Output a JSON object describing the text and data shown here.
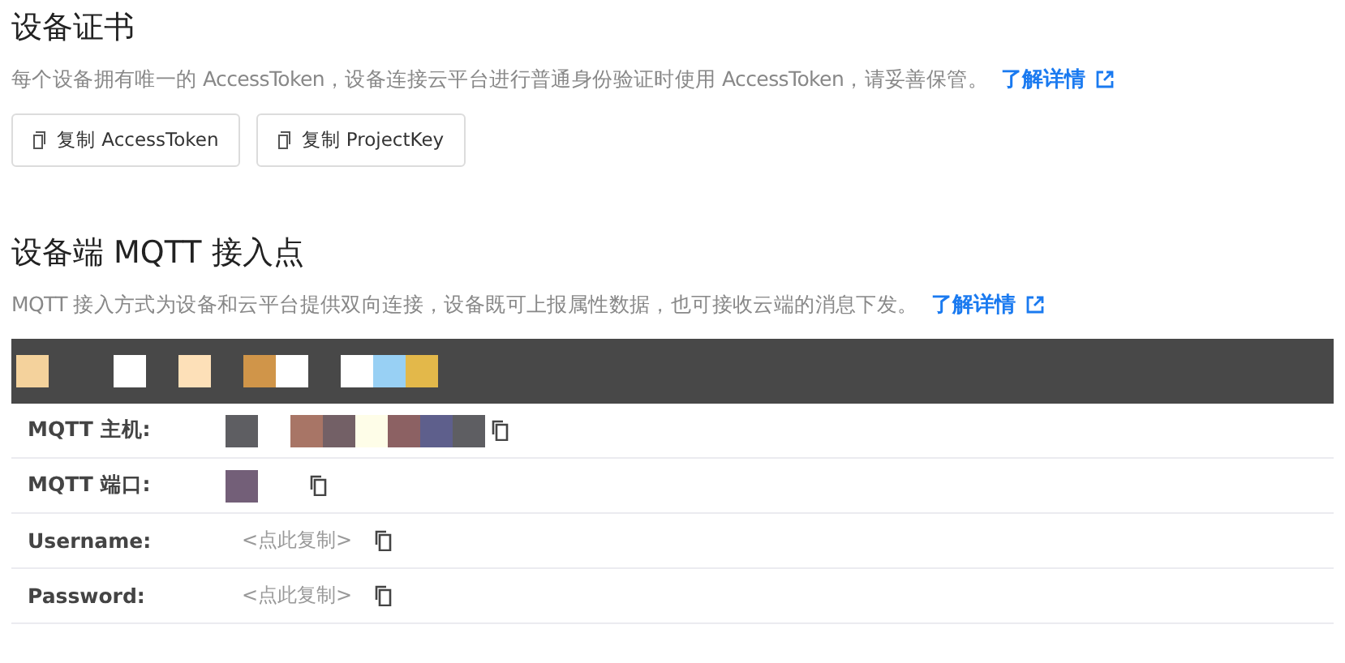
{
  "certificate": {
    "title": "设备证书",
    "description": "每个设备拥有唯一的 AccessToken，设备连接云平台进行普通身份验证时使用 AccessToken，请妥善保管。",
    "link": "了解详情",
    "buttons": [
      "复制 AccessToken",
      "复制 ProjectKey"
    ]
  },
  "mqtt": {
    "title": "设备端 MQTT 接入点",
    "description": "MQTT 接入方式为设备和云平台提供双向连接，设备既可上报属性数据，也可接收云端的消息下发。",
    "link": "了解详情",
    "rows": [
      {
        "label": "MQTT 主机:",
        "kind": "masked_host"
      },
      {
        "label": "MQTT 端口:",
        "kind": "masked_port"
      },
      {
        "label": "Username:",
        "kind": "copy",
        "value": "<点此复制>"
      },
      {
        "label": "Password:",
        "kind": "copy",
        "value": "<点此复制>"
      }
    ]
  }
}
